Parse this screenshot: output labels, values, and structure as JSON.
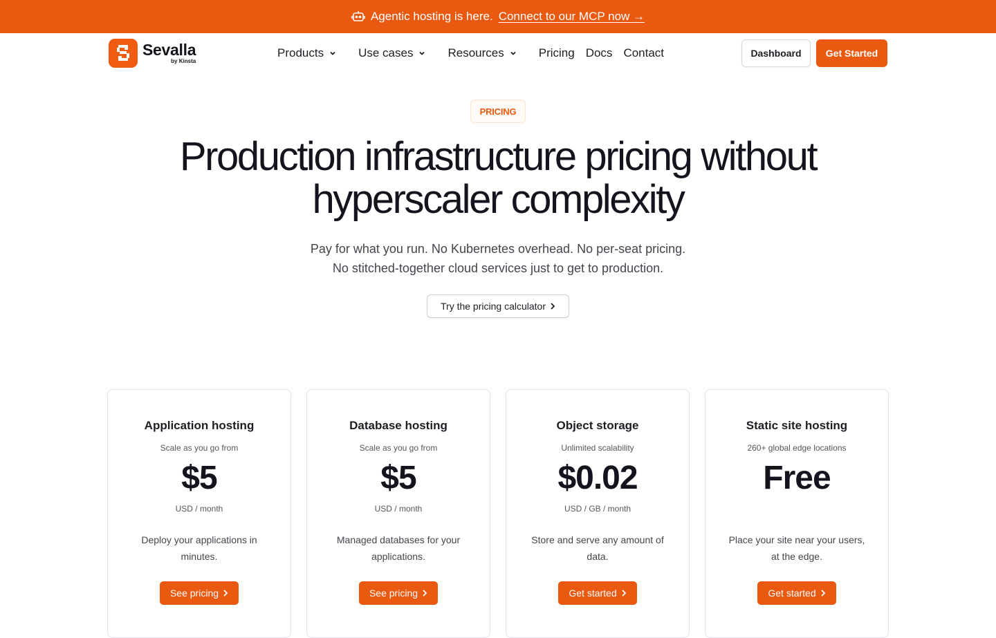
{
  "banner": {
    "text": "Agentic hosting is here.",
    "link": "Connect to our MCP now →",
    "icon": "robot-icon"
  },
  "brand": {
    "name": "Sevalla",
    "by": "by Kinsta"
  },
  "nav": {
    "items": [
      {
        "label": "Products",
        "dropdown": true
      },
      {
        "label": "Use cases",
        "dropdown": true
      },
      {
        "label": "Resources",
        "dropdown": true
      },
      {
        "label": "Pricing",
        "dropdown": false
      },
      {
        "label": "Docs",
        "dropdown": false
      },
      {
        "label": "Contact",
        "dropdown": false
      }
    ],
    "dashboard": "Dashboard",
    "get_started": "Get Started"
  },
  "hero": {
    "eyebrow": "PRICING",
    "title_line1": "Production infrastructure pricing without",
    "title_line2": "hyperscaler complexity",
    "sub_line1": "Pay for what you run. No Kubernetes overhead. No per-seat pricing.",
    "sub_line2": "No stitched-together cloud services just to get to production.",
    "calculator": "Try the pricing calculator"
  },
  "cards": [
    {
      "title": "Application hosting",
      "lead": "Scale as you go from",
      "price": "$5",
      "unit": "USD / month",
      "desc": "Deploy your applications in minutes.",
      "cta": "See pricing"
    },
    {
      "title": "Database hosting",
      "lead": "Scale as you go from",
      "price": "$5",
      "unit": "USD / month",
      "desc": "Managed databases for your applications.",
      "cta": "See pricing"
    },
    {
      "title": "Object storage",
      "lead": "Unlimited scalability",
      "price": "$0.02",
      "unit": "USD / GB / month",
      "desc": "Store and serve any amount of data.",
      "cta": "Get started"
    },
    {
      "title": "Static site hosting",
      "lead": "260+ global edge locations",
      "price": "Free",
      "unit": "",
      "desc": "Place your site near your users, at the edge.",
      "cta": "Get started"
    }
  ],
  "colors": {
    "accent": "#e9590f",
    "text": "#14141e"
  }
}
